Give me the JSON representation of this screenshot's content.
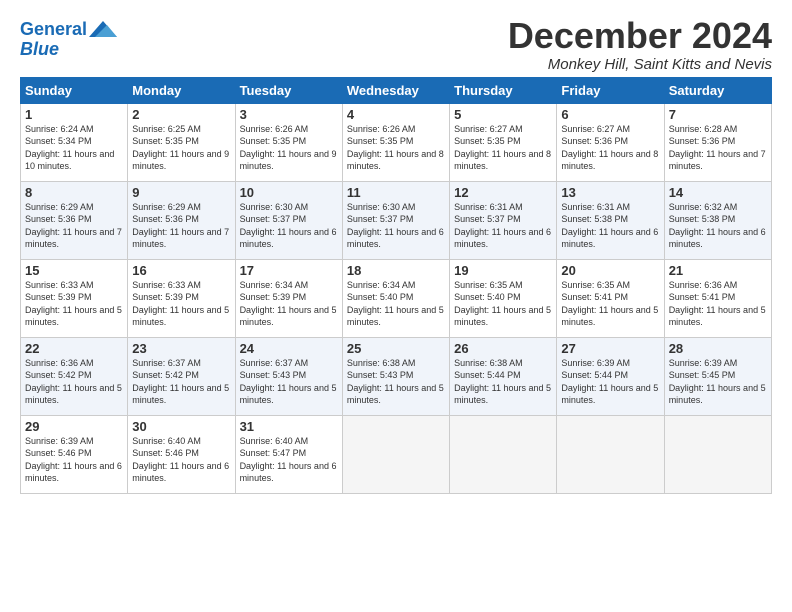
{
  "logo": {
    "text_general": "General",
    "text_blue": "Blue"
  },
  "title": "December 2024",
  "location": "Monkey Hill, Saint Kitts and Nevis",
  "days_of_week": [
    "Sunday",
    "Monday",
    "Tuesday",
    "Wednesday",
    "Thursday",
    "Friday",
    "Saturday"
  ],
  "weeks": [
    [
      {
        "day": "1",
        "sunrise": "6:24 AM",
        "sunset": "5:34 PM",
        "daylight": "11 hours and 10 minutes."
      },
      {
        "day": "2",
        "sunrise": "6:25 AM",
        "sunset": "5:35 PM",
        "daylight": "11 hours and 9 minutes."
      },
      {
        "day": "3",
        "sunrise": "6:26 AM",
        "sunset": "5:35 PM",
        "daylight": "11 hours and 9 minutes."
      },
      {
        "day": "4",
        "sunrise": "6:26 AM",
        "sunset": "5:35 PM",
        "daylight": "11 hours and 8 minutes."
      },
      {
        "day": "5",
        "sunrise": "6:27 AM",
        "sunset": "5:35 PM",
        "daylight": "11 hours and 8 minutes."
      },
      {
        "day": "6",
        "sunrise": "6:27 AM",
        "sunset": "5:36 PM",
        "daylight": "11 hours and 8 minutes."
      },
      {
        "day": "7",
        "sunrise": "6:28 AM",
        "sunset": "5:36 PM",
        "daylight": "11 hours and 7 minutes."
      }
    ],
    [
      {
        "day": "8",
        "sunrise": "6:29 AM",
        "sunset": "5:36 PM",
        "daylight": "11 hours and 7 minutes."
      },
      {
        "day": "9",
        "sunrise": "6:29 AM",
        "sunset": "5:36 PM",
        "daylight": "11 hours and 7 minutes."
      },
      {
        "day": "10",
        "sunrise": "6:30 AM",
        "sunset": "5:37 PM",
        "daylight": "11 hours and 6 minutes."
      },
      {
        "day": "11",
        "sunrise": "6:30 AM",
        "sunset": "5:37 PM",
        "daylight": "11 hours and 6 minutes."
      },
      {
        "day": "12",
        "sunrise": "6:31 AM",
        "sunset": "5:37 PM",
        "daylight": "11 hours and 6 minutes."
      },
      {
        "day": "13",
        "sunrise": "6:31 AM",
        "sunset": "5:38 PM",
        "daylight": "11 hours and 6 minutes."
      },
      {
        "day": "14",
        "sunrise": "6:32 AM",
        "sunset": "5:38 PM",
        "daylight": "11 hours and 6 minutes."
      }
    ],
    [
      {
        "day": "15",
        "sunrise": "6:33 AM",
        "sunset": "5:39 PM",
        "daylight": "11 hours and 5 minutes."
      },
      {
        "day": "16",
        "sunrise": "6:33 AM",
        "sunset": "5:39 PM",
        "daylight": "11 hours and 5 minutes."
      },
      {
        "day": "17",
        "sunrise": "6:34 AM",
        "sunset": "5:39 PM",
        "daylight": "11 hours and 5 minutes."
      },
      {
        "day": "18",
        "sunrise": "6:34 AM",
        "sunset": "5:40 PM",
        "daylight": "11 hours and 5 minutes."
      },
      {
        "day": "19",
        "sunrise": "6:35 AM",
        "sunset": "5:40 PM",
        "daylight": "11 hours and 5 minutes."
      },
      {
        "day": "20",
        "sunrise": "6:35 AM",
        "sunset": "5:41 PM",
        "daylight": "11 hours and 5 minutes."
      },
      {
        "day": "21",
        "sunrise": "6:36 AM",
        "sunset": "5:41 PM",
        "daylight": "11 hours and 5 minutes."
      }
    ],
    [
      {
        "day": "22",
        "sunrise": "6:36 AM",
        "sunset": "5:42 PM",
        "daylight": "11 hours and 5 minutes."
      },
      {
        "day": "23",
        "sunrise": "6:37 AM",
        "sunset": "5:42 PM",
        "daylight": "11 hours and 5 minutes."
      },
      {
        "day": "24",
        "sunrise": "6:37 AM",
        "sunset": "5:43 PM",
        "daylight": "11 hours and 5 minutes."
      },
      {
        "day": "25",
        "sunrise": "6:38 AM",
        "sunset": "5:43 PM",
        "daylight": "11 hours and 5 minutes."
      },
      {
        "day": "26",
        "sunrise": "6:38 AM",
        "sunset": "5:44 PM",
        "daylight": "11 hours and 5 minutes."
      },
      {
        "day": "27",
        "sunrise": "6:39 AM",
        "sunset": "5:44 PM",
        "daylight": "11 hours and 5 minutes."
      },
      {
        "day": "28",
        "sunrise": "6:39 AM",
        "sunset": "5:45 PM",
        "daylight": "11 hours and 5 minutes."
      }
    ],
    [
      {
        "day": "29",
        "sunrise": "6:39 AM",
        "sunset": "5:46 PM",
        "daylight": "11 hours and 6 minutes."
      },
      {
        "day": "30",
        "sunrise": "6:40 AM",
        "sunset": "5:46 PM",
        "daylight": "11 hours and 6 minutes."
      },
      {
        "day": "31",
        "sunrise": "6:40 AM",
        "sunset": "5:47 PM",
        "daylight": "11 hours and 6 minutes."
      },
      null,
      null,
      null,
      null
    ]
  ]
}
